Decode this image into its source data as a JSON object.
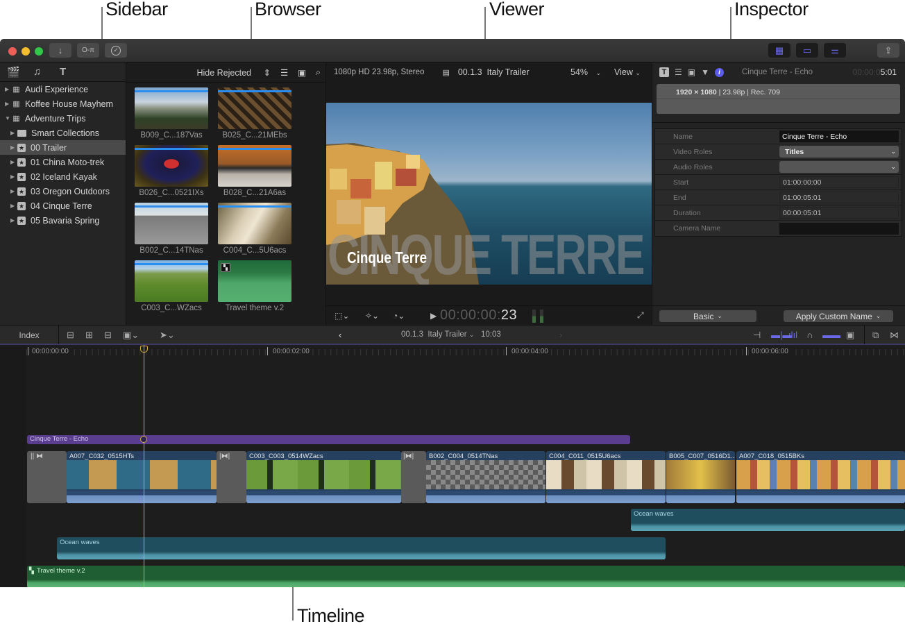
{
  "callouts": {
    "sidebar": "Sidebar",
    "browser": "Browser",
    "viewer": "Viewer",
    "inspector": "Inspector",
    "timeline": "Timeline"
  },
  "titlebar": {
    "traffic_lights": {
      "close": "#ee5f57",
      "minimize": "#f4bd2f",
      "zoom": "#32c748"
    },
    "left_buttons": [
      {
        "name": "import-media",
        "icon": "↓"
      },
      {
        "name": "keywords",
        "icon": "O-π"
      },
      {
        "name": "background-tasks",
        "icon": "✓"
      }
    ],
    "right_buttons": [
      {
        "name": "show-browser",
        "icon": "▦"
      },
      {
        "name": "show-timeline",
        "icon": "▭"
      },
      {
        "name": "show-inspector",
        "icon": "⚌"
      }
    ],
    "share_icon": "⇪",
    "accent": "#6a6af0"
  },
  "sidebar": {
    "tab_icons": [
      "libraries-icon",
      "photos-audio-icon",
      "titles-generators-icon"
    ],
    "items": [
      {
        "label": "Audi Experience",
        "type": "library",
        "level": 0,
        "expanded": false
      },
      {
        "label": "Koffee House Mayhem",
        "type": "library",
        "level": 0,
        "expanded": false
      },
      {
        "label": "Adventure Trips",
        "type": "library",
        "level": 0,
        "expanded": true
      },
      {
        "label": "Smart Collections",
        "type": "folder",
        "level": 1,
        "expanded": false
      },
      {
        "label": "00 Trailer",
        "type": "event",
        "level": 1,
        "expanded": false,
        "selected": true
      },
      {
        "label": "01 China Moto-trek",
        "type": "event",
        "level": 1,
        "expanded": false
      },
      {
        "label": "02 Iceland Kayak",
        "type": "event",
        "level": 1,
        "expanded": false
      },
      {
        "label": "03 Oregon Outdoors",
        "type": "event",
        "level": 1,
        "expanded": false
      },
      {
        "label": "04 Cinque Terre",
        "type": "event",
        "level": 1,
        "expanded": false
      },
      {
        "label": "05 Bavaria Spring",
        "type": "event",
        "level": 1,
        "expanded": false
      }
    ]
  },
  "browser": {
    "filter": "Hide Rejected",
    "clips": [
      {
        "label": "B009_C...187Vas",
        "kind": "video"
      },
      {
        "label": "B025_C...21MEbs",
        "kind": "video"
      },
      {
        "label": "B026_C...0521IXs",
        "kind": "video"
      },
      {
        "label": "B028_C...21A6as",
        "kind": "video"
      },
      {
        "label": "B002_C...14TNas",
        "kind": "video"
      },
      {
        "label": "C004_C...5U6acs",
        "kind": "video"
      },
      {
        "label": "C003_C...WZacs",
        "kind": "video"
      },
      {
        "label": "Travel theme v.2",
        "kind": "audio"
      }
    ]
  },
  "viewer": {
    "format": "1080p HD 23.98p, Stereo",
    "project": "00.1.3  Italy Trailer",
    "zoom": "54%",
    "view_menu": "View",
    "title_overlay_small": "Cinque Terre",
    "title_overlay_large": "CINQUE TERRE",
    "timecode_dim": "00:00:00:",
    "timecode_bright": "23"
  },
  "inspector": {
    "clip_name": "Cinque Terre - Echo",
    "duration_dim": "00:00:0",
    "duration_bright": "5:01",
    "resolution": "1920 × 1080",
    "format_rest": " | 23.98p | Rec. 709",
    "rows": [
      {
        "label": "Name",
        "value": "Cinque Terre - Echo",
        "kind": "field"
      },
      {
        "label": "Video Roles",
        "value": "Titles",
        "kind": "popup"
      },
      {
        "label": "Audio Roles",
        "value": "",
        "kind": "popup"
      },
      {
        "label": "Start",
        "value": "01:00:00:00",
        "kind": "plain"
      },
      {
        "label": "End",
        "value": "01:00:05:01",
        "kind": "plain"
      },
      {
        "label": "Duration",
        "value": "00:00:05:01",
        "kind": "plain"
      },
      {
        "label": "Camera Name",
        "value": "",
        "kind": "field"
      }
    ],
    "metadata_view": "Basic",
    "apply_name": "Apply Custom Name"
  },
  "timeline_bar": {
    "index_label": "Index",
    "project": "00.1.3  Italy Trailer",
    "duration": "10:03"
  },
  "timeline": {
    "ruler": [
      "00:00:00:00",
      "00:00:02:00",
      "00:00:04:00",
      "00:00:06:00"
    ],
    "title_clip": "Cinque Terre - Echo",
    "video_clips": [
      "A007_C032_0515HTs",
      "C003_C003_0514WZacs",
      "B002_C004_0514TNas",
      "C004_C011_0515U6acs",
      "B005_C007_0516D1...",
      "A007_C018_0515BKs"
    ],
    "audio_clips": [
      {
        "label": "Ocean waves",
        "lane": "upper"
      },
      {
        "label": "Ocean waves",
        "lane": "lower"
      },
      {
        "label": "Travel theme v.2",
        "lane": "music"
      }
    ],
    "playhead_color": "#d8b23a",
    "title_color": "#5a3d8f",
    "video_color": "#26405f",
    "audio_color": "#1f4f5e",
    "music_color": "#1f5d32"
  }
}
